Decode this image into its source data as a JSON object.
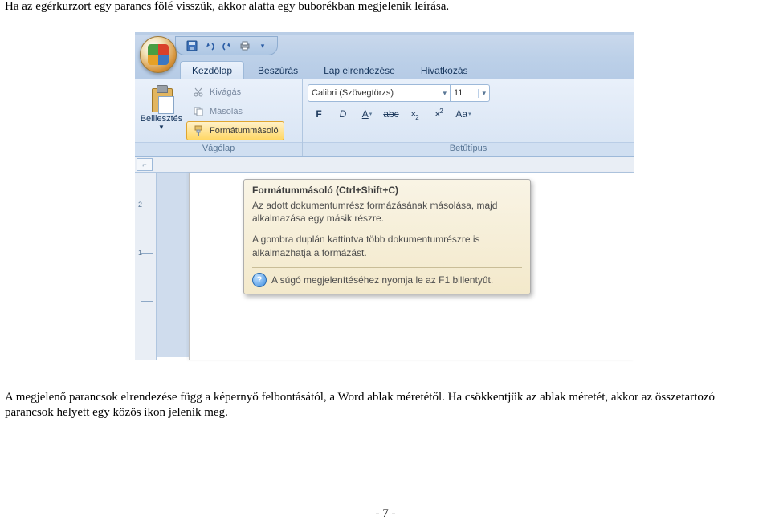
{
  "doc": {
    "paragraph1": "Ha az egérkurzort egy parancs fölé visszük, akkor alatta egy buborékban megjelenik leírása.",
    "paragraph2": "A megjelenő parancsok elrendezése függ a képernyő felbontásától, a Word ablak méretétől. Ha csökkentjük az ablak méretét, akkor az összetartozó parancsok helyett egy közös ikon jelenik meg.",
    "page_number": "- 7 -"
  },
  "word": {
    "qat_more": "▾",
    "tabs": [
      "Kezdőlap",
      "Beszúrás",
      "Lap elrendezése",
      "Hivatkozás"
    ],
    "active_tab": 0,
    "clipboard": {
      "paste_label": "Beillesztés",
      "cut": "Kivágás",
      "copy": "Másolás",
      "format_painter": "Formátummásoló",
      "group_title": "Vágólap"
    },
    "font": {
      "name": "Calibri (Szövegtörzs)",
      "size": "11",
      "bold": "F",
      "italic": "D",
      "underline": "A",
      "strike": "abc",
      "sub": "×",
      "sup": "×",
      "case": "Aa",
      "group_title": "Betűtípus"
    },
    "ruler_corner": "⌐",
    "vruler_marks": [
      "2",
      "1"
    ]
  },
  "tooltip": {
    "title": "Formátummásoló (Ctrl+Shift+C)",
    "line1": "Az adott dokumentumrész formázásának másolása, majd alkalmazása egy másik részre.",
    "line2": "A gombra duplán kattintva több dokumentumrészre is alkalmazhatja a formázást.",
    "help": "A súgó megjelenítéséhez nyomja le az F1 billentyűt."
  }
}
